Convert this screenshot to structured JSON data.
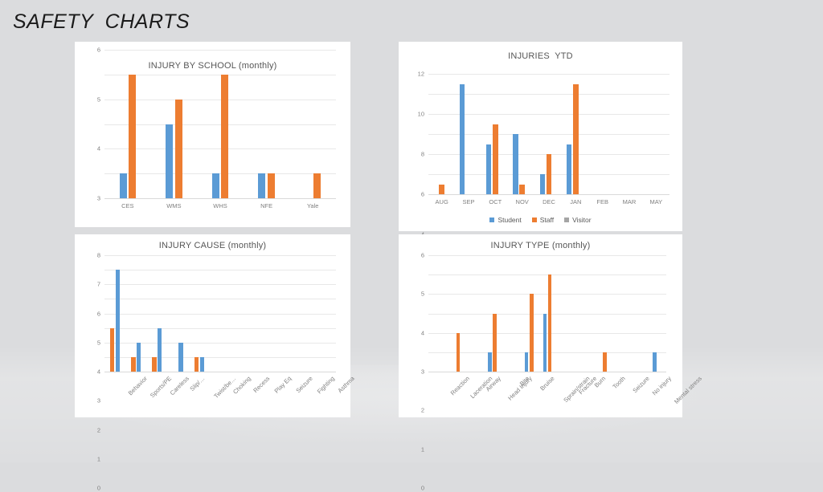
{
  "slide": {
    "title": "SAFETY  CHARTS",
    "background_color": "#dbdcde"
  },
  "palette": {
    "series_blue": "#5b9bd5",
    "series_orange": "#ed7d31",
    "series_gray": "#a5a5a5",
    "card_background": "#ffffff",
    "gridline": "#e8e8e8",
    "tick_text": "#7f7f7f",
    "title_text": "#565656"
  },
  "chart_data": [
    {
      "id": "injury-by-school",
      "type": "bar",
      "title": "INJURY BY SCHOOL (monthly)",
      "xlabel": "",
      "ylabel": "",
      "ylim": [
        0,
        6
      ],
      "yticks": [
        0,
        1,
        2,
        3,
        4,
        5,
        6
      ],
      "grid": true,
      "legend": false,
      "label_rotation": 0,
      "categories": [
        "CES",
        "WMS",
        "WHS",
        "NFE",
        "Yale"
      ],
      "series": [
        {
          "name": "Student",
          "color": "#5b9bd5",
          "values": [
            1,
            3,
            1,
            1,
            0
          ]
        },
        {
          "name": "Staff",
          "color": "#ed7d31",
          "values": [
            5,
            4,
            5,
            1,
            1
          ]
        }
      ]
    },
    {
      "id": "injuries-ytd",
      "type": "bar",
      "title": "INJURIES  YTD",
      "xlabel": "",
      "ylabel": "",
      "ylim": [
        0,
        12
      ],
      "yticks": [
        0,
        2,
        4,
        6,
        8,
        10,
        12
      ],
      "grid": true,
      "legend": true,
      "legend_position": "bottom",
      "label_rotation": 0,
      "categories": [
        "AUG",
        "SEP",
        "OCT",
        "NOV",
        "DEC",
        "JAN",
        "FEB",
        "MAR",
        "MAY"
      ],
      "series": [
        {
          "name": "Student",
          "color": "#5b9bd5",
          "values": [
            0,
            11,
            5,
            6,
            2,
            5,
            0,
            0,
            0
          ]
        },
        {
          "name": "Staff",
          "color": "#ed7d31",
          "values": [
            1,
            0,
            7,
            1,
            4,
            11,
            0,
            0,
            0
          ]
        },
        {
          "name": "Visitor",
          "color": "#a5a5a5",
          "values": [
            0,
            0,
            0,
            0,
            0,
            0,
            0,
            0,
            0
          ]
        }
      ]
    },
    {
      "id": "injury-cause",
      "type": "bar",
      "title": "INJURY CAUSE (monthly)",
      "xlabel": "",
      "ylabel": "",
      "ylim": [
        0,
        8
      ],
      "yticks": [
        0,
        1,
        2,
        3,
        4,
        5,
        6,
        7,
        8
      ],
      "grid": true,
      "legend": false,
      "label_rotation": -45,
      "categories": [
        "Behavior",
        "Sports/PE",
        "Careless",
        "Slip/…",
        "Twist/be…",
        "Choking",
        "Recess",
        "Play Eq",
        "Seizure",
        "Fighting",
        "Asthma"
      ],
      "series": [
        {
          "name": "Staff",
          "color": "#ed7d31",
          "values": [
            3,
            1,
            1,
            0,
            1,
            0,
            0,
            0,
            0,
            0,
            0
          ]
        },
        {
          "name": "Student",
          "color": "#5b9bd5",
          "values": [
            7,
            2,
            3,
            2,
            1,
            0,
            0,
            0,
            0,
            0,
            0
          ]
        }
      ]
    },
    {
      "id": "injury-type",
      "type": "bar",
      "title": "INJURY TYPE (monthly)",
      "xlabel": "",
      "ylabel": "",
      "ylim": [
        0,
        6
      ],
      "yticks": [
        0,
        1,
        2,
        3,
        4,
        5,
        6
      ],
      "grid": true,
      "legend": false,
      "label_rotation": -45,
      "categories": [
        "Reaction",
        "Laceration",
        "Airway",
        "Head Injury",
        "Bite",
        "Bruise",
        "Sprain/strain",
        "Fracture",
        "Burn",
        "Tooth",
        "Seizure",
        "No injury",
        "Mental stress"
      ],
      "series": [
        {
          "name": "Student",
          "color": "#5b9bd5",
          "values": [
            0,
            0,
            0,
            1,
            0,
            1,
            3,
            0,
            0,
            0,
            0,
            0,
            1
          ]
        },
        {
          "name": "Staff",
          "color": "#ed7d31",
          "values": [
            0,
            2,
            0,
            3,
            0,
            4,
            5,
            0,
            0,
            1,
            0,
            0,
            0
          ]
        }
      ]
    }
  ]
}
